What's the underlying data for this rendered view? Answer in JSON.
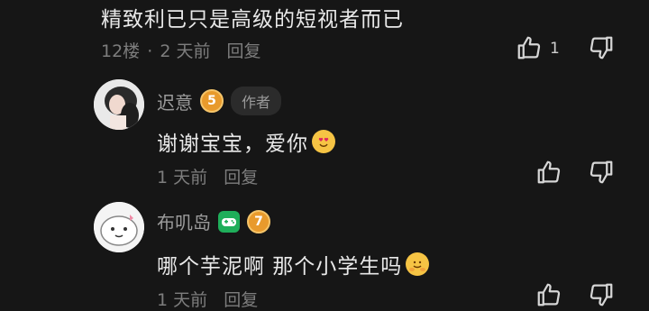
{
  "comments": [
    {
      "text": "精致利已只是高级的短视者而已",
      "meta_floor": "12楼",
      "meta_dot": "·",
      "meta_time": "2 天前",
      "meta_reply": "回复",
      "like_count": "1"
    },
    {
      "user": "迟意",
      "level": "5",
      "author_tag": "作者",
      "text": "谢谢宝宝，爱你",
      "emoji": "heart-eyes-emoji",
      "meta_time": "1 天前",
      "meta_reply": "回复"
    },
    {
      "user": "布叽岛",
      "level": "7",
      "text": "哪个芋泥啊 那个小学生吗",
      "emoji": "hug-emoji",
      "meta_time": "1 天前",
      "meta_reply": "回复"
    }
  ],
  "colors": {
    "background": "#161616",
    "badge": "#e89a2c",
    "game_badge": "#1fae5a"
  }
}
